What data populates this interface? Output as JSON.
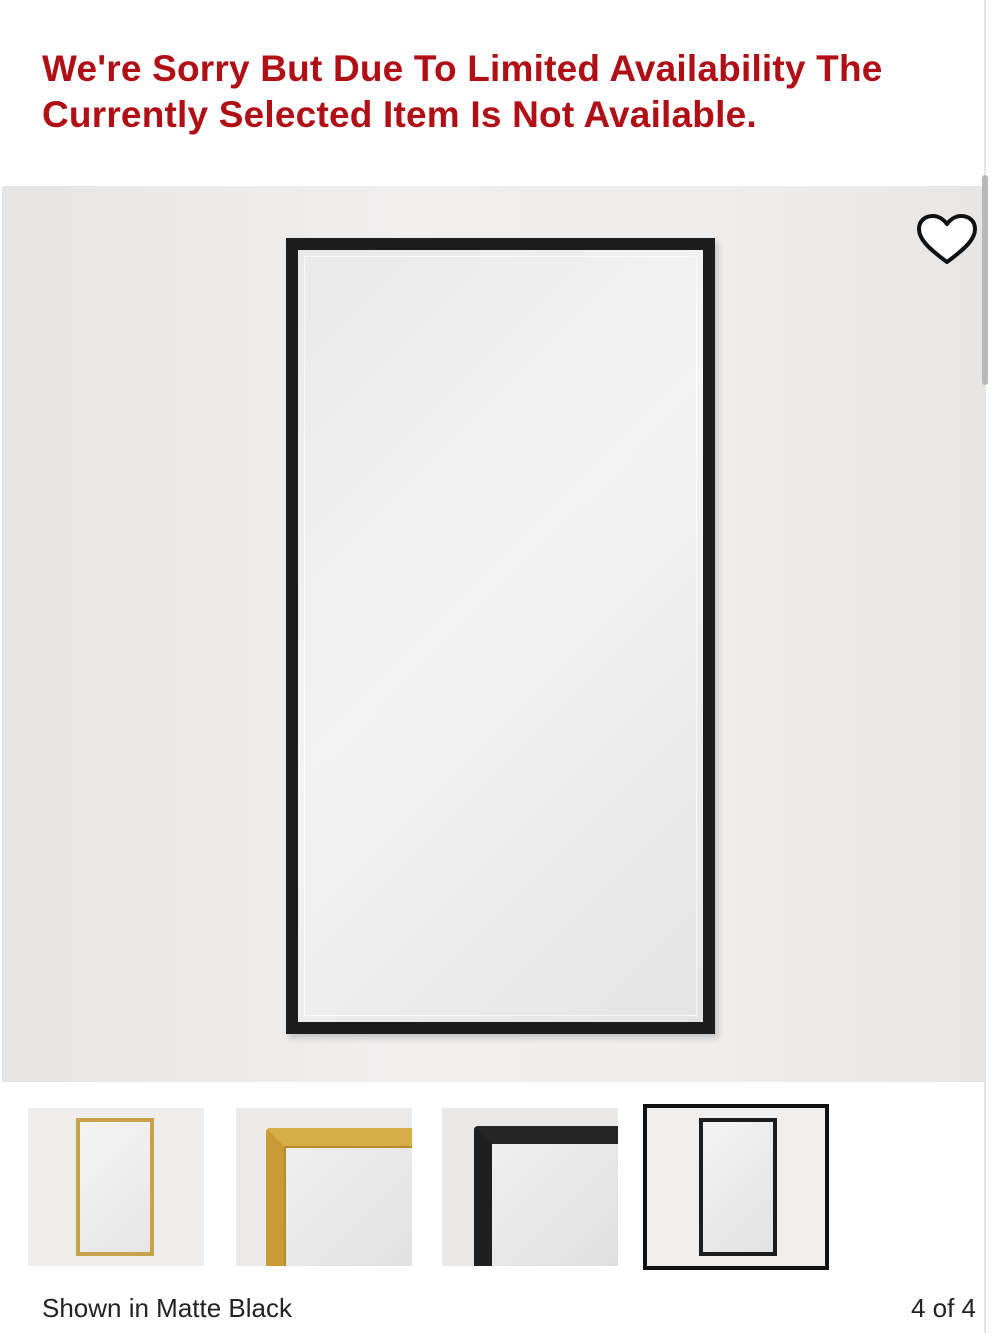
{
  "alert": {
    "message": "We're Sorry But Due To Limited Availability The Currently Selected Item Is Not Available."
  },
  "gallery": {
    "favorite_icon": "heart-outline-icon",
    "thumbnails": [
      {
        "icon": "gold-mirror-full-thumbnail"
      },
      {
        "icon": "gold-mirror-corner-thumbnail"
      },
      {
        "icon": "black-mirror-corner-thumbnail"
      },
      {
        "icon": "black-mirror-full-thumbnail",
        "selected": true
      }
    ],
    "caption": "Shown in Matte Black",
    "counter": "4 of 4"
  },
  "colors": {
    "alert_text": "#b00f16",
    "frame_black": "#1d1d1d",
    "frame_gold": "#c9a24c"
  }
}
